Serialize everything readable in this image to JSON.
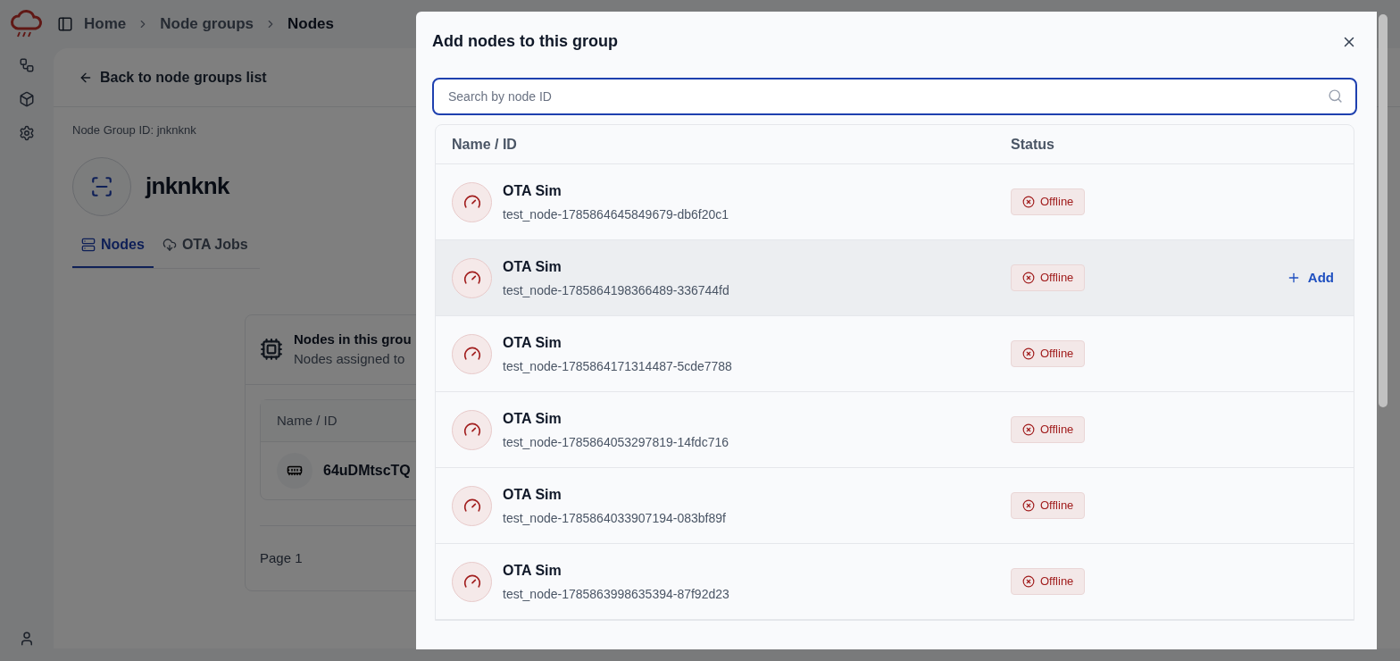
{
  "breadcrumb": [
    {
      "label": "Home",
      "current": false
    },
    {
      "label": "Node groups",
      "current": false
    },
    {
      "label": "Nodes",
      "current": true
    }
  ],
  "back_link": "Back to node groups list",
  "group_id_label": "Node Group ID: jnknknk",
  "group_name": "jnknknk",
  "tabs": [
    {
      "label": "Nodes",
      "selected": true
    },
    {
      "label": "OTA Jobs",
      "selected": false
    }
  ],
  "nodes_card": {
    "title": "Nodes in this grou",
    "subtitle": "Nodes assigned to",
    "column": "Name / ID",
    "rows": [
      "64uDMtscTQ"
    ],
    "page": "Page 1"
  },
  "dialog": {
    "title": "Add nodes to this group",
    "search": {
      "placeholder": "Search by node ID"
    },
    "columns": [
      "Name / ID",
      "Status"
    ],
    "rows": [
      {
        "name": "OTA Sim",
        "id": "test_node-1785864645849679-db6f20c1",
        "status": "Offline",
        "highlighted": false
      },
      {
        "name": "OTA Sim",
        "id": "test_node-1785864198366489-336744fd",
        "status": "Offline",
        "highlighted": true,
        "action": "Add"
      },
      {
        "name": "OTA Sim",
        "id": "test_node-1785864171314487-5cde7788",
        "status": "Offline",
        "highlighted": false
      },
      {
        "name": "OTA Sim",
        "id": "test_node-1785864053297819-14fdc716",
        "status": "Offline",
        "highlighted": false
      },
      {
        "name": "OTA Sim",
        "id": "test_node-1785864033907194-083bf89f",
        "status": "Offline",
        "highlighted": false
      },
      {
        "name": "OTA Sim",
        "id": "test_node-1785863998635394-87f92d23",
        "status": "Offline",
        "highlighted": false
      }
    ]
  }
}
